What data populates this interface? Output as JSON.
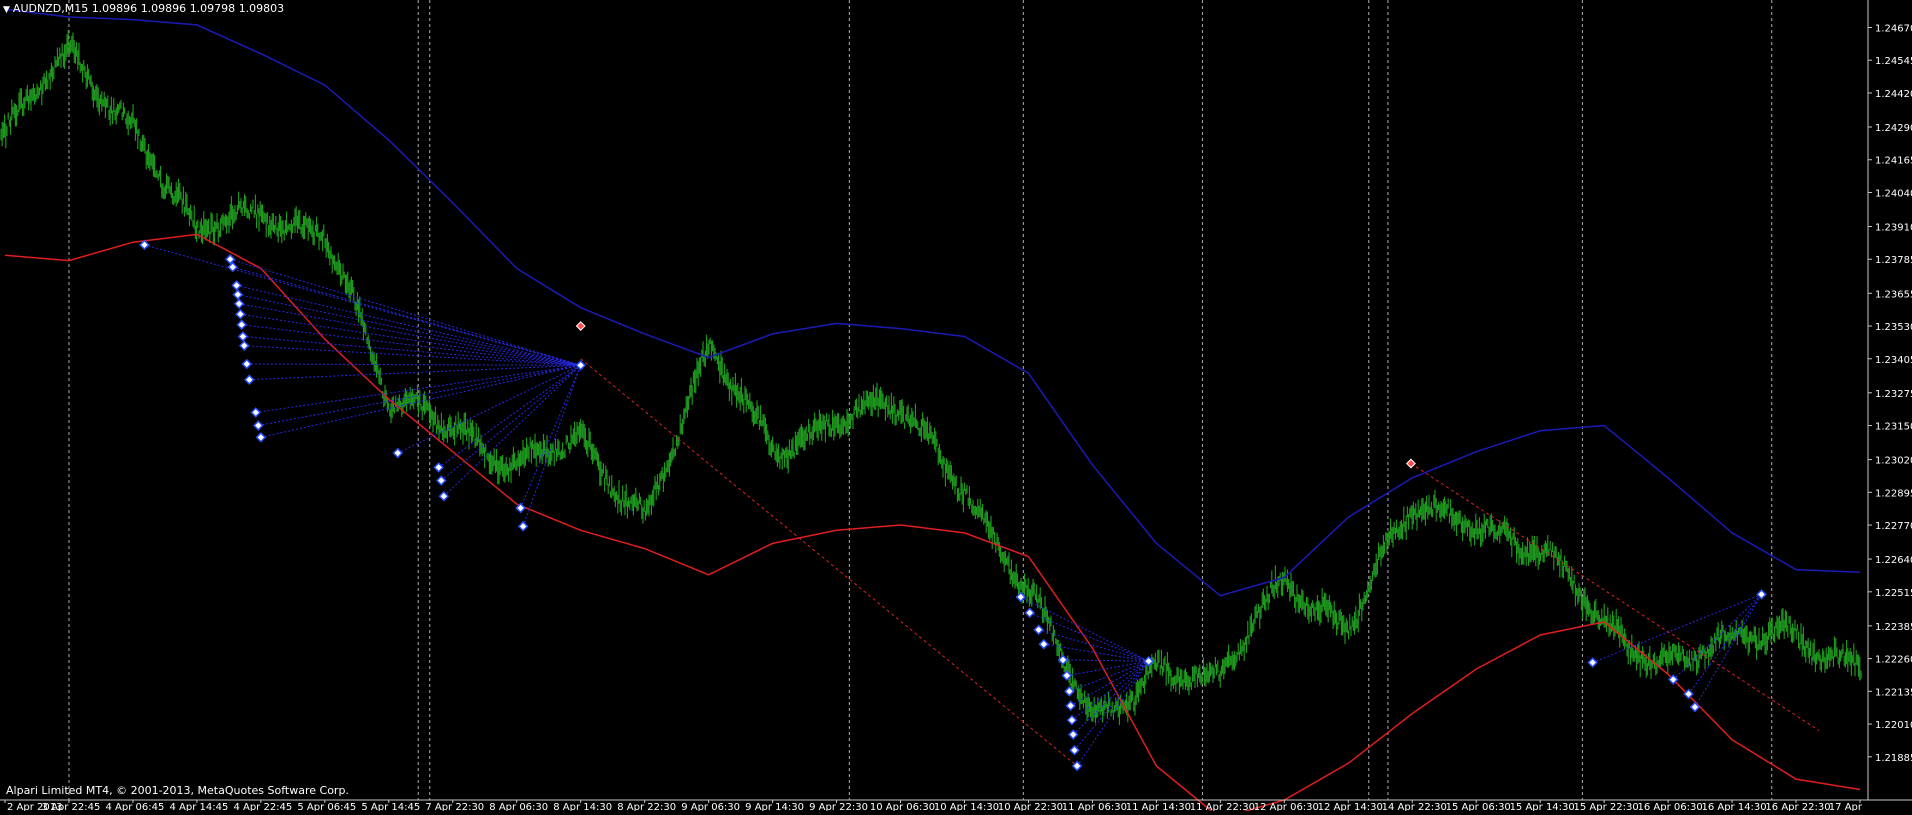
{
  "header": {
    "symbol": "AUDNZD,M15",
    "open": "1.09896",
    "high": "1.09896",
    "low": "1.09798",
    "close": "1.09803"
  },
  "copyright": "Alpari Limited MT4, © 2001-2013, MetaQuotes Software Corp.",
  "colors": {
    "background": "#000000",
    "price": "#1fa11f",
    "upper_band": "#1b1bb8",
    "lower_band": "#e01e1e",
    "fan_lines": "#2828e6",
    "trend_line": "#dc2323",
    "separator": "#cccccc",
    "axis": "#c8c8c8"
  },
  "chart_data": {
    "type": "line",
    "title": "AUDNZD,M15",
    "ylim": [
      1.2172,
      1.24775
    ],
    "y_ticks": [
      "1.24670",
      "1.24545",
      "1.24420",
      "1.24290",
      "1.24165",
      "1.24040",
      "1.23910",
      "1.23785",
      "1.23655",
      "1.23530",
      "1.23405",
      "1.23275",
      "1.23150",
      "1.23020",
      "1.22895",
      "1.22770",
      "1.22640",
      "1.22515",
      "1.22385",
      "1.22260",
      "1.22135",
      "1.22010",
      "1.21885"
    ],
    "x_ticks": [
      "2 Apr 2013",
      "3 Apr 22:45",
      "4 Apr 06:45",
      "4 Apr 14:45",
      "4 Apr 22:45",
      "5 Apr 06:45",
      "5 Apr 14:45",
      "7 Apr 22:30",
      "8 Apr 06:30",
      "8 Apr 14:30",
      "8 Apr 22:30",
      "9 Apr 06:30",
      "9 Apr 14:30",
      "9 Apr 22:30",
      "10 Apr 06:30",
      "10 Apr 14:30",
      "10 Apr 22:30",
      "11 Apr 06:30",
      "11 Apr 14:30",
      "11 Apr 22:30",
      "12 Apr 06:30",
      "12 Apr 14:30",
      "14 Apr 22:30",
      "15 Apr 06:30",
      "15 Apr 14:30",
      "15 Apr 22:30",
      "16 Apr 06:30",
      "16 Apr 14:30",
      "16 Apr 22:30",
      "17 Apr"
    ],
    "series": [
      {
        "x": [
          "2 Apr 2013",
          "3 Apr 22:45",
          "4 Apr 06:45",
          "4 Apr 14:45",
          "4 Apr 22:45",
          "5 Apr 06:45",
          "5 Apr 14:45",
          "7 Apr 22:30",
          "8 Apr 06:30",
          "8 Apr 14:30",
          "8 Apr 22:30",
          "9 Apr 06:30",
          "9 Apr 14:30",
          "9 Apr 22:30",
          "10 Apr 06:30",
          "10 Apr 14:30",
          "10 Apr 22:30",
          "11 Apr 06:30",
          "11 Apr 14:30",
          "11 Apr 22:30",
          "12 Apr 06:30",
          "12 Apr 14:30",
          "14 Apr 22:30",
          "15 Apr 06:30",
          "15 Apr 14:30",
          "15 Apr 22:30",
          "16 Apr 06:30",
          "16 Apr 14:30",
          "16 Apr 22:30",
          "17 Apr"
        ],
        "values": [
          1.2425,
          1.2455,
          1.2433,
          1.2385,
          1.2397,
          1.2392,
          1.232,
          1.232,
          1.2298,
          1.2307,
          1.2284,
          1.234,
          1.2307,
          1.232,
          1.2318,
          1.2295,
          1.225,
          1.22,
          1.2226,
          1.2214,
          1.2258,
          1.224,
          1.228,
          1.2282,
          1.2266,
          1.2237,
          1.2228,
          1.2229,
          1.2237,
          1.2225
        ]
      },
      {
        "x": [
          "2 Apr 2013",
          "3 Apr 22:45",
          "4 Apr 06:45",
          "4 Apr 14:45",
          "4 Apr 22:45",
          "5 Apr 06:45",
          "5 Apr 14:45",
          "7 Apr 22:30",
          "8 Apr 06:30",
          "8 Apr 14:30",
          "8 Apr 22:30",
          "9 Apr 06:30",
          "9 Apr 14:30",
          "9 Apr 22:30",
          "10 Apr 06:30",
          "10 Apr 14:30",
          "10 Apr 22:30",
          "11 Apr 06:30",
          "11 Apr 14:30",
          "11 Apr 22:30",
          "12 Apr 06:30",
          "12 Apr 14:30",
          "14 Apr 22:30",
          "15 Apr 06:30",
          "15 Apr 14:30",
          "15 Apr 22:30",
          "16 Apr 06:30",
          "16 Apr 14:30",
          "16 Apr 22:30",
          "17 Apr"
        ],
        "values": [
          1.2474,
          1.2471,
          1.247,
          1.2468,
          1.2457,
          1.2445,
          1.2424,
          1.24,
          1.2375,
          1.236,
          1.235,
          1.2341,
          1.235,
          1.2354,
          1.2352,
          1.2349,
          1.2335,
          1.23,
          1.227,
          1.225,
          1.2257,
          1.228,
          1.2295,
          1.2305,
          1.2313,
          1.2315,
          1.2295,
          1.2274,
          1.226,
          1.2259
        ]
      },
      {
        "x": [
          "2 Apr 2013",
          "3 Apr 22:45",
          "4 Apr 06:45",
          "4 Apr 14:45",
          "4 Apr 22:45",
          "5 Apr 06:45",
          "5 Apr 14:45",
          "7 Apr 22:30",
          "8 Apr 06:30",
          "8 Apr 14:30",
          "8 Apr 22:30",
          "9 Apr 06:30",
          "9 Apr 14:30",
          "9 Apr 22:30",
          "10 Apr 06:30",
          "10 Apr 14:30",
          "10 Apr 22:30",
          "11 Apr 06:30",
          "11 Apr 14:30",
          "11 Apr 22:30",
          "12 Apr 06:30",
          "12 Apr 14:30",
          "14 Apr 22:30",
          "15 Apr 06:30",
          "15 Apr 14:30",
          "15 Apr 22:30",
          "16 Apr 06:30",
          "16 Apr 14:30",
          "16 Apr 22:30",
          "17 Apr"
        ],
        "values": [
          1.238,
          1.2378,
          1.2385,
          1.2388,
          1.2375,
          1.2348,
          1.2325,
          1.2305,
          1.2285,
          1.2275,
          1.2268,
          1.2258,
          1.227,
          1.2275,
          1.2277,
          1.2274,
          1.2265,
          1.223,
          1.2185,
          1.2165,
          1.2172,
          1.2186,
          1.2205,
          1.2222,
          1.2235,
          1.224,
          1.222,
          1.2195,
          1.218,
          1.2176
        ]
      }
    ],
    "fan_groups": [
      {
        "target": [
          9.0,
          1.2338
        ],
        "sources": [
          [
            2.18,
            1.2384
          ],
          [
            3.52,
            1.23785
          ],
          [
            3.56,
            1.23755
          ],
          [
            3.62,
            1.23685
          ],
          [
            3.64,
            1.2365
          ],
          [
            3.66,
            1.23615
          ],
          [
            3.68,
            1.23575
          ],
          [
            3.7,
            1.23535
          ],
          [
            3.72,
            1.2349
          ],
          [
            3.74,
            1.23455
          ],
          [
            3.78,
            1.23385
          ],
          [
            3.82,
            1.23325
          ],
          [
            3.92,
            1.232
          ],
          [
            3.96,
            1.2315
          ],
          [
            4.0,
            1.23105
          ],
          [
            6.14,
            1.23045
          ],
          [
            6.78,
            1.2299
          ],
          [
            6.82,
            1.2294
          ],
          [
            6.86,
            1.2288
          ],
          [
            8.06,
            1.22835
          ],
          [
            8.1,
            1.22765
          ]
        ]
      },
      {
        "target": [
          17.88,
          1.2225
        ],
        "sources": [
          [
            15.88,
            1.22495
          ],
          [
            16.02,
            1.22435
          ],
          [
            16.16,
            1.2237
          ],
          [
            16.24,
            1.22315
          ],
          [
            16.54,
            1.22255
          ],
          [
            16.6,
            1.22195
          ],
          [
            16.64,
            1.22135
          ],
          [
            16.66,
            1.2208
          ],
          [
            16.68,
            1.22025
          ],
          [
            16.7,
            1.2197
          ],
          [
            16.72,
            1.2191
          ],
          [
            16.76,
            1.2185
          ]
        ]
      },
      {
        "target": [
          27.46,
          1.22505
        ],
        "sources": [
          [
            24.82,
            1.22245
          ],
          [
            26.08,
            1.2218
          ],
          [
            26.32,
            1.22125
          ],
          [
            26.42,
            1.22075
          ]
        ]
      }
    ],
    "red_markers": [
      [
        9.0,
        1.2353
      ],
      [
        21.98,
        1.23005
      ]
    ],
    "trend_lines": [
      [
        [
          9.0,
          1.23405
        ],
        [
          16.76,
          1.2185
        ]
      ],
      [
        [
          21.98,
          1.23005
        ],
        [
          28.36,
          1.21985
        ]
      ]
    ],
    "session_separators": [
      1.0,
      6.46,
      6.64,
      13.2,
      15.92,
      18.72,
      21.32,
      21.62,
      24.66,
      27.62
    ]
  }
}
